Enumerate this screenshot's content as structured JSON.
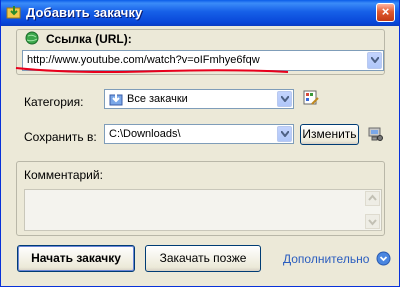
{
  "window": {
    "title": "Добавить закачку",
    "close_label": "×"
  },
  "url": {
    "label": "Ссылка (URL):",
    "value": "http://www.youtube.com/watch?v=oIFmhye6fqw"
  },
  "category": {
    "label": "Категория:",
    "value": "Все закачки"
  },
  "save": {
    "label": "Сохранить в:",
    "value": "C:\\Downloads\\",
    "change_label": "Изменить"
  },
  "comment": {
    "label": "Комментарий:",
    "value": ""
  },
  "buttons": {
    "start": "Начать закачку",
    "later": "Закачать позже",
    "more": "Дополнительно"
  },
  "colors": {
    "titlebar": "#0a5ce8",
    "accent_link": "#2a5dbf",
    "annotation_red": "#e8001c",
    "dialog_bg": "#ece9d8"
  },
  "icons": [
    "app-download-icon",
    "close-icon",
    "globe-icon",
    "category-folder-icon",
    "category-edit-icon",
    "network-folder-icon",
    "expand-circle-icon"
  ]
}
